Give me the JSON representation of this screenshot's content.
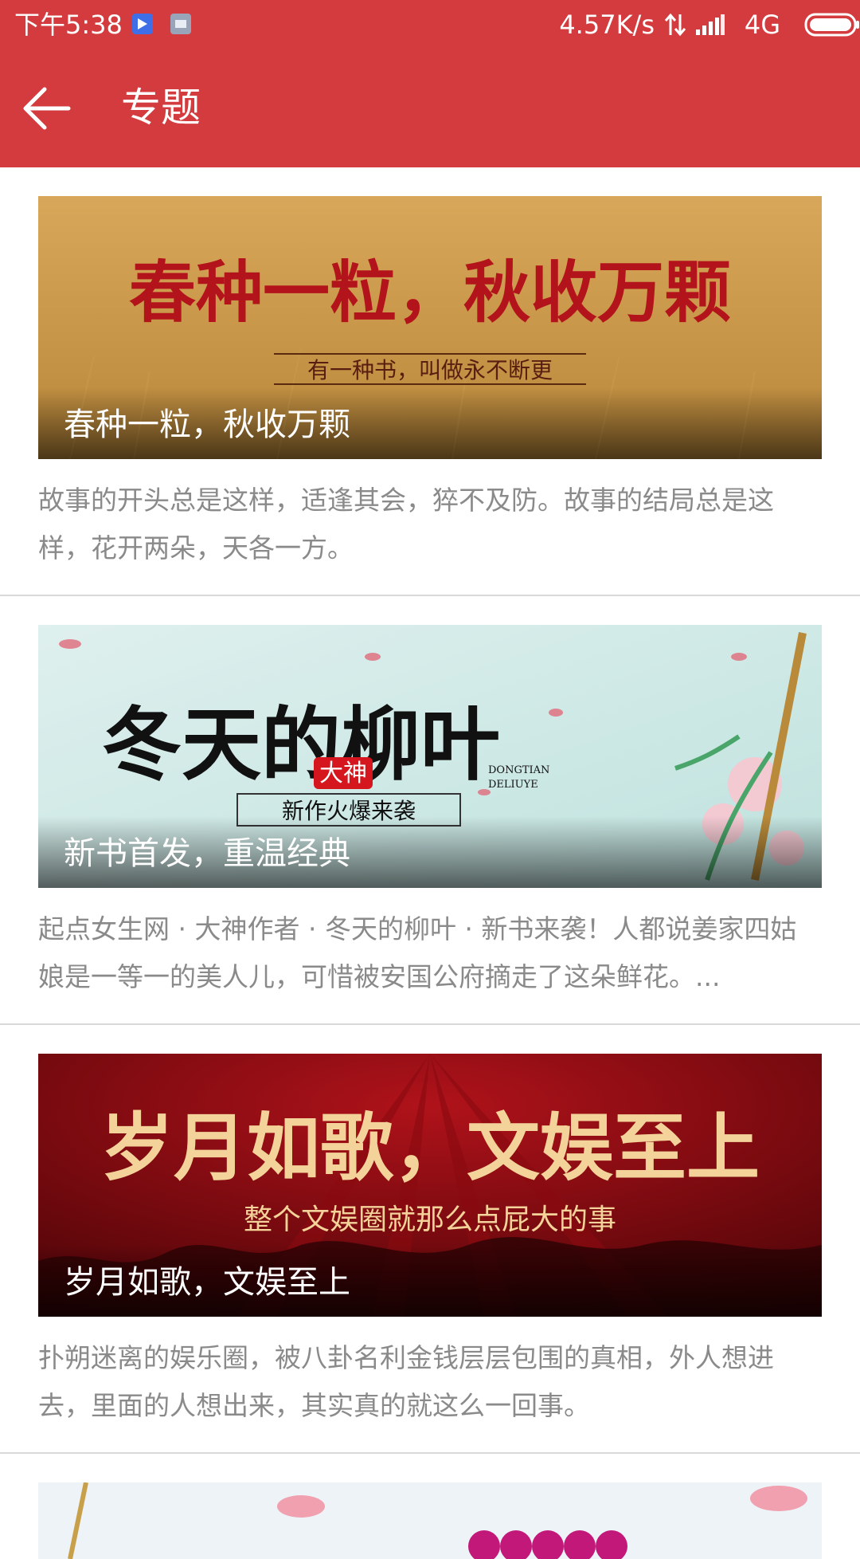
{
  "status_bar": {
    "time": "下午5:38",
    "net_speed": "4.57K/s",
    "network_type": "4G",
    "icons": [
      "notification-app-icon",
      "notification-message-icon",
      "data-transfer-icon",
      "signal-icon",
      "battery-icon"
    ]
  },
  "header": {
    "title": "专题",
    "back_icon": "back-arrow-icon"
  },
  "colors": {
    "header_bg": "#d33b3e",
    "desc_text": "#8a8a8a",
    "divider": "#d8d8d8"
  },
  "topics": [
    {
      "banner_title": "春种一粒，秋收万颗",
      "banner_subtitle": "有一种书，叫做永不断更",
      "caption": "春种一粒，秋收万颗",
      "description": "故事的开头总是这样，适逢其会，猝不及防。故事的结局总是这样，花开两朵，天各一方。"
    },
    {
      "banner_title": "冬天的柳叶",
      "banner_badge": "大神",
      "banner_subtitle": "新作火爆来袭",
      "banner_pinyin_1": "DONGTIAN",
      "banner_pinyin_2": "DELIUYE",
      "caption": "新书首发，重温经典",
      "description": "起点女生网 · 大神作者 · 冬天的柳叶 · 新书来袭！人都说姜家四姑娘是一等一的美人儿，可惜被安国公府摘走了这朵鲜花。..."
    },
    {
      "banner_title": "岁月如歌，文娱至上",
      "banner_subtitle": "整个文娱圈就那么点屁大的事",
      "caption": "岁月如歌，文娱至上",
      "description": "扑朔迷离的娱乐圈，被八卦名利金钱层层包围的真相，外人想进去，里面的人想出来，其实真的就这么一回事。"
    },
    {
      "caption": ""
    }
  ]
}
